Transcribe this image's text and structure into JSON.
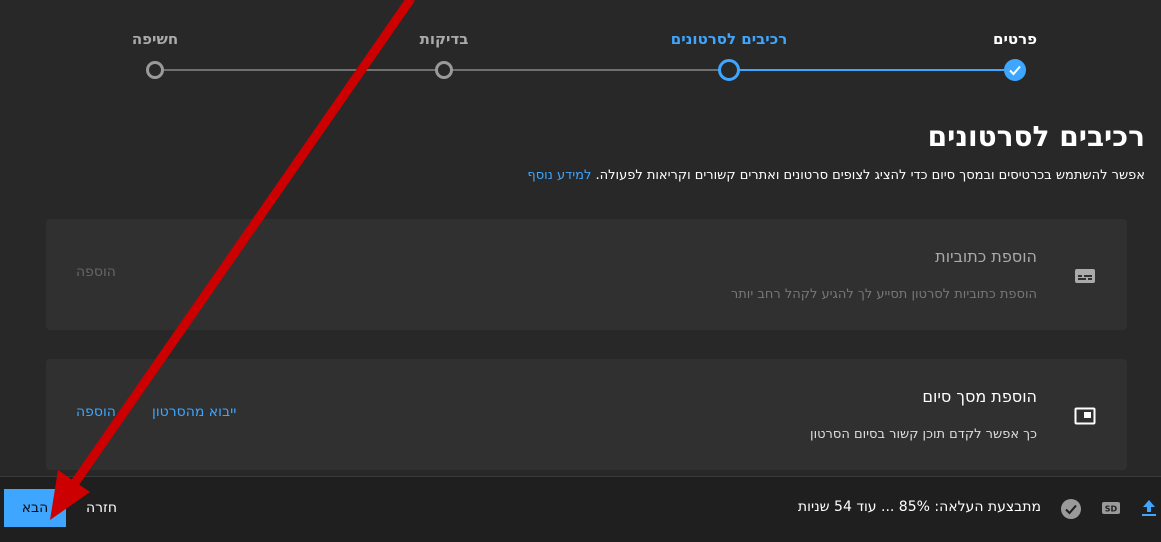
{
  "stepper": {
    "steps": [
      {
        "label": "פרטים",
        "state": "done"
      },
      {
        "label": "רכיבים לסרטונים",
        "state": "current"
      },
      {
        "label": "בדיקות",
        "state": "pending"
      },
      {
        "label": "חשיפה",
        "state": "pending"
      }
    ]
  },
  "page": {
    "title": "רכיבים לסרטונים",
    "description": "אפשר להשתמש בכרטיסים ובמסך סיום כדי להציג לצופים סרטונים ואתרים קשורים וקריאות לפעולה.",
    "learn_more": "למידע נוסף"
  },
  "cards": [
    {
      "icon": "subtitles-icon",
      "title": "הוספת כתוביות",
      "subtitle": "הוספת כתוביות לסרטון תסייע לך להגיע לקהל רחב יותר",
      "actions": [
        "הוספה"
      ]
    },
    {
      "icon": "end-screen-icon",
      "title": "הוספת מסך סיום",
      "subtitle": "כך אפשר לקדם תוכן קשור בסיום הסרטון",
      "actions": [
        "ייבוא מהסרטון",
        "הוספה"
      ]
    }
  ],
  "footer": {
    "status": "מתבצעת העלאה: 85% ... עוד 54 שניות",
    "back_label": "חזרה",
    "next_label": "הבא",
    "icons": [
      "upload-icon",
      "sd-icon",
      "check-circle-icon"
    ]
  },
  "colors": {
    "accent": "#3ea6ff",
    "background": "#282828",
    "card": "#303030",
    "annotation_arrow": "#cc0000"
  }
}
